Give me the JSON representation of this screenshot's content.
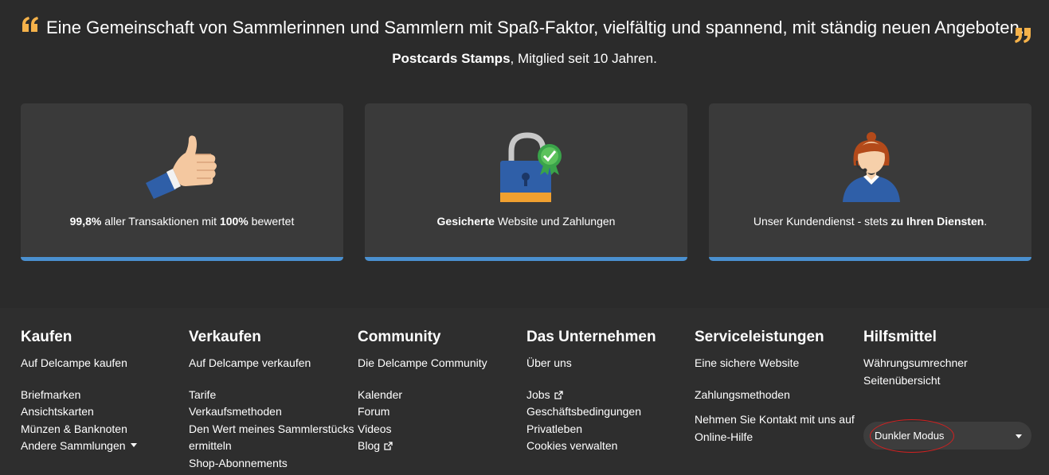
{
  "testimonial": {
    "quote": "Eine Gemeinschaft von Sammlerinnen und Sammlern mit Spaß-Faktor, vielfältig und spannend, mit ständig neuen Angeboten.",
    "author_name": "Postcards Stamps",
    "author_suffix": ", Mitglied seit 10 Jahren."
  },
  "features": [
    {
      "icon": "thumbs-up-icon",
      "bold1": "99,8%",
      "text1": " aller Transaktionen mit ",
      "bold2": "100%",
      "text2": " bewertet"
    },
    {
      "icon": "padlock-icon",
      "bold1": "Gesicherte",
      "text1": " Website und Zahlungen"
    },
    {
      "icon": "customer-service-agent-icon",
      "text1": "Unser Kundendienst - stets ",
      "bold1": "zu Ihren Diensten",
      "text2": "."
    }
  ],
  "footer": {
    "kaufen": {
      "title": "Kaufen",
      "links": [
        "Auf Delcampe kaufen",
        "Briefmarken",
        "Ansichtskarten",
        "Münzen & Banknoten",
        "Andere Sammlungen"
      ]
    },
    "verkaufen": {
      "title": "Verkaufen",
      "links": [
        "Auf Delcampe verkaufen",
        "Tarife",
        "Verkaufsmethoden",
        "Den Wert meines Sammlerstücks",
        "ermitteln",
        "Shop-Abonnements"
      ]
    },
    "community": {
      "title": "Community",
      "links": [
        "Die Delcampe Community",
        "Kalender",
        "Forum",
        "Videos",
        "Blog"
      ]
    },
    "unternehmen": {
      "title": "Das Unternehmen",
      "links": [
        "Über uns",
        "Jobs",
        "Geschäftsbedingungen",
        "Privatleben",
        "Cookies verwalten"
      ]
    },
    "service": {
      "title": "Serviceleistungen",
      "links": [
        "Eine sichere Website",
        "Zahlungsmethoden",
        "Nehmen Sie Kontakt mit uns auf",
        "Online-Hilfe"
      ]
    },
    "hilfsmittel": {
      "title": "Hilfsmittel",
      "links": [
        "Währungsumrechner",
        "Seitenübersicht"
      ],
      "mode_select": "Dunkler Modus"
    }
  },
  "colors": {
    "accent_quote": "#f5b24a",
    "card_bar": "#4a90d0",
    "background": "#2b2b2b",
    "annotation": "#d32020"
  }
}
